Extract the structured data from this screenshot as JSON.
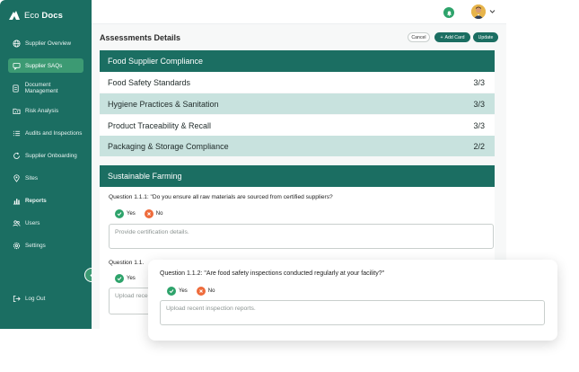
{
  "app": {
    "name_light": "Eco",
    "name_bold": "Docs"
  },
  "sidebar": {
    "items": [
      {
        "label": "Supplier Overview",
        "icon": "globe-icon"
      },
      {
        "label": "Supplier SAQs",
        "icon": "chat-icon",
        "active": true
      },
      {
        "label": "Document Management",
        "icon": "document-icon"
      },
      {
        "label": "Risk Analysis",
        "icon": "folder-chart-icon"
      },
      {
        "label": "Audits and Inspections",
        "icon": "checklist-icon"
      },
      {
        "label": "Supplier Onboarding",
        "icon": "refresh-icon"
      },
      {
        "label": "Sites",
        "icon": "location-icon"
      },
      {
        "label": "Reports",
        "icon": "bar-chart-icon",
        "bold": true
      },
      {
        "label": "Users",
        "icon": "users-icon"
      },
      {
        "label": "Settings",
        "icon": "gear-icon"
      }
    ],
    "logout": {
      "label": "Log Out",
      "icon": "logout-icon"
    }
  },
  "header": {
    "icons": [
      "bell-icon",
      "avatar",
      "chevron-down-icon"
    ]
  },
  "main": {
    "title": "Assessments Details",
    "buttons": {
      "cancel": "Cancel",
      "add_card": "Add Card",
      "update": "Update"
    },
    "section1": {
      "title": "Food Supplier Compliance",
      "rows": [
        {
          "label": "Food Safety Standards",
          "score": "3/3"
        },
        {
          "label": "Hygiene Practices & Sanitation",
          "score": "3/3"
        },
        {
          "label": "Product Traceability & Recall",
          "score": "3/3"
        },
        {
          "label": "Packaging & Storage Compliance",
          "score": "2/2"
        }
      ]
    },
    "section2": {
      "title": "Sustainable Farming",
      "q1": {
        "text": "Question 1.1.1: \"Do you ensure all raw materials are sourced from certified suppliers?",
        "yes": "Yes",
        "no": "No",
        "placeholder": "Provide certification details."
      },
      "q2_partial": {
        "text": "Question 1.1.",
        "yes": "Yes",
        "placeholder": "Upload rece"
      }
    }
  },
  "floating_card": {
    "text": "Question 1.1.2: \"Are food safety inspections conducted regularly at your facility?\"",
    "yes": "Yes",
    "no": "No",
    "placeholder": "Upload recent inspection reports."
  },
  "colors": {
    "primary": "#1b6e62",
    "active_nav": "#3c9a73",
    "row_alt": "#c8e2de",
    "yes": "#2ea36b",
    "no": "#ee6b3b"
  }
}
